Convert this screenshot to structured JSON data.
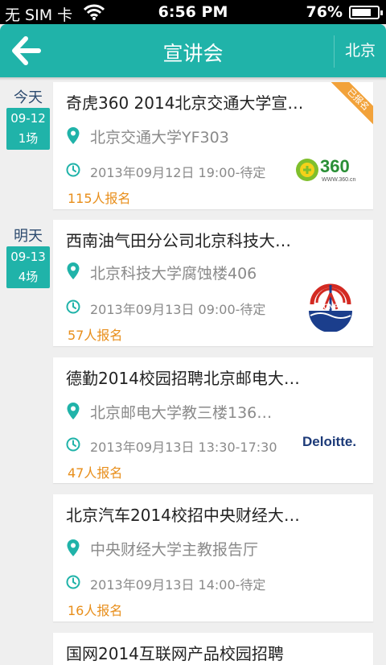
{
  "status_bar": {
    "carrier": "无 SIM 卡",
    "time": "6:56 PM",
    "battery_pct": "76%",
    "battery_level": 0.76
  },
  "header": {
    "title": "宣讲会",
    "city": "北京"
  },
  "days": [
    {
      "label": "今天",
      "date": "09-12",
      "count": "1场"
    },
    {
      "label": "明天",
      "date": "09-13",
      "count": "4场"
    }
  ],
  "events": [
    {
      "title": "奇虎360 2014北京交通大学宣…",
      "location": "北京交通大学YF303",
      "time": "2013年09月12日 19:00-待定",
      "registrations": "115人报名",
      "badge": "已报名",
      "logo": "360-logo",
      "logo_text": "360",
      "logo_subtext": "WWW.360.cn"
    },
    {
      "title": "西南油气田分公司北京科技大…",
      "location": "北京科技大学腐蚀楼406",
      "time": "2013年09月13日 09:00-待定",
      "registrations": "57人报名",
      "logo": "cnpc-logo",
      "logo_text": "CNPC"
    },
    {
      "title": "德勤2014校园招聘北京邮电大…",
      "location": "北京邮电大学教三楼136…",
      "time": "2013年09月13日 13:30-17:30",
      "registrations": "47人报名",
      "logo": "deloitte-logo",
      "logo_text": "Deloitte."
    },
    {
      "title": "北京汽车2014校招中央财经大…",
      "location": "中央财经大学主教报告厅",
      "time": "2013年09月13日 14:00-待定",
      "registrations": "16人报名"
    },
    {
      "title": "国网2014互联网产品校园招聘"
    }
  ],
  "colors": {
    "accent": "#20b3a9",
    "registrations": "#e88e1a",
    "badge": "#f2a23a"
  }
}
